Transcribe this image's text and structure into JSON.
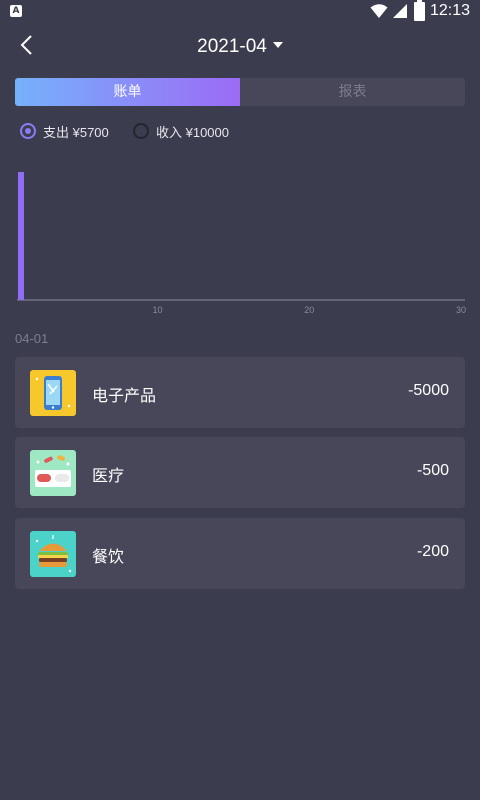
{
  "status_bar": {
    "time": "12:13",
    "icons": [
      "notification-icon",
      "wifi-icon",
      "signal-icon",
      "battery-icon"
    ]
  },
  "header": {
    "title": "2021-04",
    "back_icon": "back-arrow-icon",
    "dropdown_icon": "caret-down-icon"
  },
  "tabs": [
    {
      "label": "账单",
      "active": true
    },
    {
      "label": "报表",
      "active": false
    }
  ],
  "filters": [
    {
      "label": "支出 ¥5700",
      "checked": true
    },
    {
      "label": "收入 ¥10000",
      "checked": false
    }
  ],
  "chart_data": {
    "type": "bar",
    "x_ticks": [
      "10",
      "20",
      "30"
    ],
    "xlim": [
      1,
      30
    ],
    "series": [
      {
        "values": [
          {
            "x": 1,
            "y": 5700
          }
        ]
      }
    ],
    "colors": {
      "bar": "#8f6df5",
      "axis": "#8a8a9c"
    }
  },
  "list": {
    "date": "04-01",
    "items": [
      {
        "name": "电子产品",
        "amount": "-5000",
        "icon": "electronics-phone-icon"
      },
      {
        "name": "医疗",
        "amount": "-500",
        "icon": "medical-pills-icon"
      },
      {
        "name": "餐饮",
        "amount": "-200",
        "icon": "food-burger-icon"
      }
    ]
  },
  "colors": {
    "background": "#3c3c4f",
    "card": "#474759",
    "accent_start": "#76b1fb",
    "accent_end": "#9c6bf6",
    "radio": "#8a7cf4"
  }
}
